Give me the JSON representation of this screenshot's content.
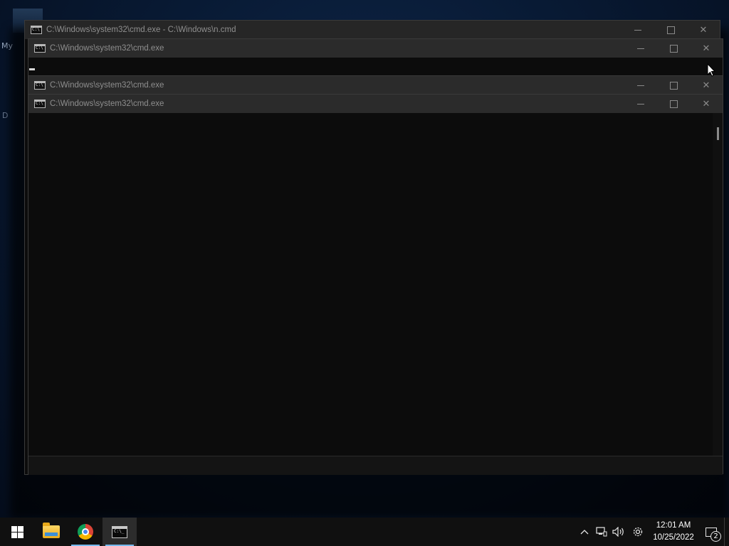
{
  "desktop": {
    "label_fragment_1": "My",
    "label_fragment_2": "D"
  },
  "windows": [
    {
      "title": "C:\\Windows\\system32\\cmd.exe - C:\\Windows\\n.cmd"
    },
    {
      "title": "C:\\Windows\\system32\\cmd.exe"
    },
    {
      "title": "C:\\Windows\\system32\\cmd.exe"
    },
    {
      "title": "C:\\Windows\\system32\\cmd.exe"
    }
  ],
  "window_controls": {
    "close_glyph": "✕"
  },
  "taskbar": {
    "start_icon": "windows-logo-icon",
    "pinned": [
      {
        "name": "file-explorer",
        "icon": "folder-icon"
      },
      {
        "name": "google-chrome",
        "icon": "chrome-icon"
      },
      {
        "name": "command-prompt",
        "icon": "cmd-icon",
        "active": true
      }
    ],
    "tray": {
      "chevron": "^",
      "network": "🖧",
      "volume": "🔊",
      "settings": "⚙"
    },
    "clock": {
      "time": "12:01 AM",
      "date": "10/25/2022"
    },
    "notifications": {
      "count": "2"
    }
  },
  "colors": {
    "console_bg": "#0c0c0c",
    "titlebar_bg": "#2b2b2b",
    "taskbar_bg": "#101010",
    "taskbar_accent": "#76b9ed"
  }
}
